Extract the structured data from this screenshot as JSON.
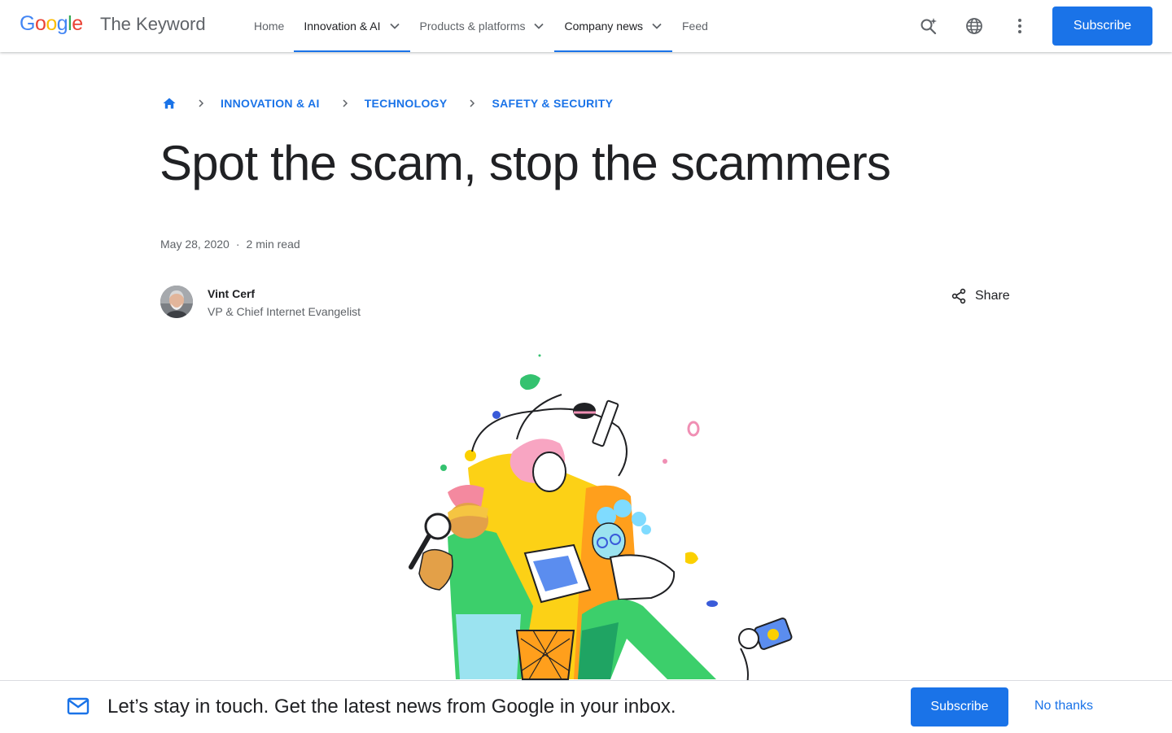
{
  "header": {
    "logo_letters": [
      {
        "char": "G",
        "color": "#4285F4"
      },
      {
        "char": "o",
        "color": "#EA4335"
      },
      {
        "char": "o",
        "color": "#FBBC05"
      },
      {
        "char": "g",
        "color": "#4285F4"
      },
      {
        "char": "l",
        "color": "#34A853"
      },
      {
        "char": "e",
        "color": "#EA4335"
      }
    ],
    "logo_text": "Google",
    "site_title": "The Keyword",
    "nav": [
      {
        "label": "Home",
        "dropdown": false,
        "active": false
      },
      {
        "label": "Innovation & AI",
        "dropdown": true,
        "active": true
      },
      {
        "label": "Products & platforms",
        "dropdown": true,
        "active": false
      },
      {
        "label": "Company news",
        "dropdown": true,
        "active": true
      },
      {
        "label": "Feed",
        "dropdown": false,
        "active": false
      }
    ],
    "icons": [
      "search-sparkle-icon",
      "globe-icon",
      "more-vert-icon"
    ],
    "subscribe_label": "Subscribe"
  },
  "breadcrumb": {
    "home_icon": "home-icon",
    "items": [
      "INNOVATION & AI",
      "TECHNOLOGY",
      "SAFETY & SECURITY"
    ]
  },
  "article": {
    "title": "Spot the scam, stop the scammers",
    "date": "May 28, 2020",
    "separator": "·",
    "read_time": "2 min read",
    "author": {
      "name": "Vint Cerf",
      "role": "VP & Chief Internet Evangelist"
    },
    "share_label": "Share"
  },
  "newsletter": {
    "icon": "mail-icon",
    "text": "Let’s stay in touch. Get the latest news from Google in your inbox.",
    "subscribe_label": "Subscribe",
    "dismiss_label": "No thanks"
  },
  "colors": {
    "accent": "#1a73e8",
    "text": "#202124",
    "muted": "#5f6368"
  }
}
